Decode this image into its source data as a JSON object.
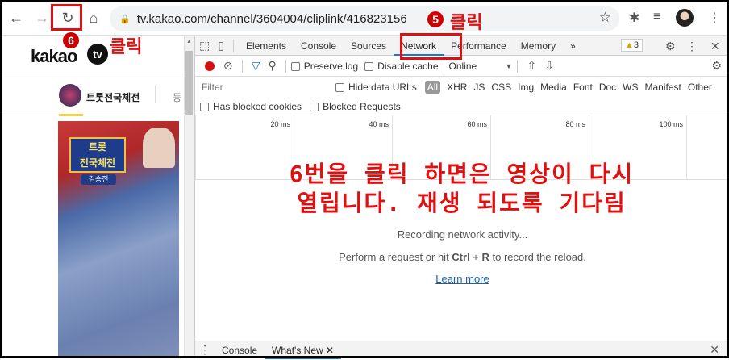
{
  "browser": {
    "url": "tv.kakao.com/channel/3604004/cliplink/416823156"
  },
  "page": {
    "logo": "kakao",
    "logo_tv": "tv",
    "channel_name": "트롯전국체전",
    "channel_next": "동",
    "thumb_tag": "트롯\n전국체전",
    "thumb_sub": "김승전"
  },
  "annotations": {
    "step5_num": "5",
    "step5_text": "클릭",
    "step6_num": "6",
    "step6_text": "클릭",
    "line1": "6번을 클릭 하면은 영상이 다시",
    "line2": "열립니다. 재생 되도록 기다림"
  },
  "devtools": {
    "tabs": [
      "Elements",
      "Console",
      "Sources",
      "Network",
      "Performance",
      "Memory"
    ],
    "more": "»",
    "warnings": "3",
    "preserve_log": "Preserve log",
    "disable_cache": "Disable cache",
    "throttle": "Online",
    "filter_placeholder": "Filter",
    "hide_data_urls": "Hide data URLs",
    "types": [
      "All",
      "XHR",
      "JS",
      "CSS",
      "Img",
      "Media",
      "Font",
      "Doc",
      "WS",
      "Manifest",
      "Other"
    ],
    "has_blocked_cookies": "Has blocked cookies",
    "blocked_requests": "Blocked Requests",
    "ticks": [
      "20 ms",
      "40 ms",
      "60 ms",
      "80 ms",
      "100 ms"
    ],
    "recording": "Recording network activity...",
    "hint_pre": "Perform a request or hit ",
    "hint_key1": "Ctrl",
    "hint_plus": " + ",
    "hint_key2": "R",
    "hint_post": " to record the reload.",
    "learn_more": "Learn more",
    "drawer_tabs": [
      "Console",
      "What's New"
    ]
  },
  "colors": {
    "accent": "#1a73e8",
    "annotation": "#e01010"
  }
}
